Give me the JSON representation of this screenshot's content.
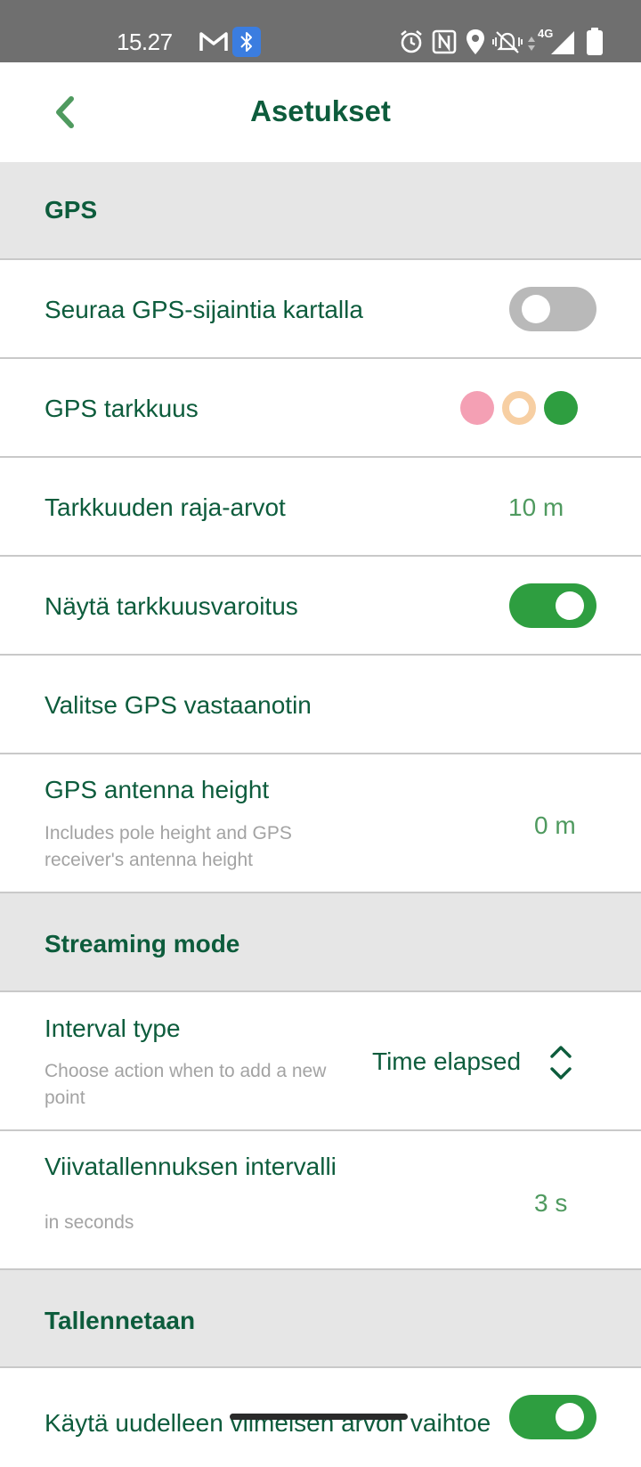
{
  "status_bar": {
    "time": "15.27",
    "network_label": "4G",
    "icons": [
      "gmail-icon",
      "bluetooth-icon",
      "alarm-icon",
      "nfc-icon",
      "location-icon",
      "mute-icon",
      "data-arrows-icon",
      "signal-icon",
      "battery-icon"
    ]
  },
  "header": {
    "title": "Asetukset",
    "back_icon": "chevron-left-icon"
  },
  "sections": {
    "gps": "GPS",
    "streaming": "Streaming mode",
    "saving": "Tallennetaan"
  },
  "rows": {
    "follow_gps": {
      "label": "Seuraa GPS-sijaintia kartalla",
      "enabled": false
    },
    "gps_accuracy": {
      "label": "GPS tarkkuus",
      "indicators": [
        {
          "name": "poor",
          "color": "#f4a0b4"
        },
        {
          "name": "moderate",
          "color": "#f7cfa3"
        },
        {
          "name": "good",
          "color": "#2e9e40"
        }
      ]
    },
    "accuracy_thresholds": {
      "label": "Tarkkuuden raja-arvot",
      "value": "10 m"
    },
    "show_accuracy_warning": {
      "label": "Näytä tarkkuusvaroitus",
      "enabled": true
    },
    "select_receiver": {
      "label": "Valitse GPS vastaanotin"
    },
    "antenna_height": {
      "label": "GPS antenna height",
      "description": "Includes pole height and GPS receiver's antenna height",
      "value": "0 m"
    },
    "interval_type": {
      "label": "Interval type",
      "description": "Choose action when to add a new point",
      "value": "Time elapsed",
      "icon": "up-down-chevron-icon"
    },
    "line_interval": {
      "label": "Viivatallennuksen intervalli",
      "description": "in seconds",
      "value": "3 s"
    },
    "reuse_last_value": {
      "label": "Käytä uudelleen viimeisen arvon vaihtoe",
      "enabled": true
    }
  },
  "colors": {
    "primary_text": "#0d5c3c",
    "value_text": "#4f9a5f",
    "toggle_on": "#2e9e40",
    "toggle_off": "#b9b9b9",
    "section_bg": "#e6e6e6",
    "divider": "#c9c9c9"
  }
}
